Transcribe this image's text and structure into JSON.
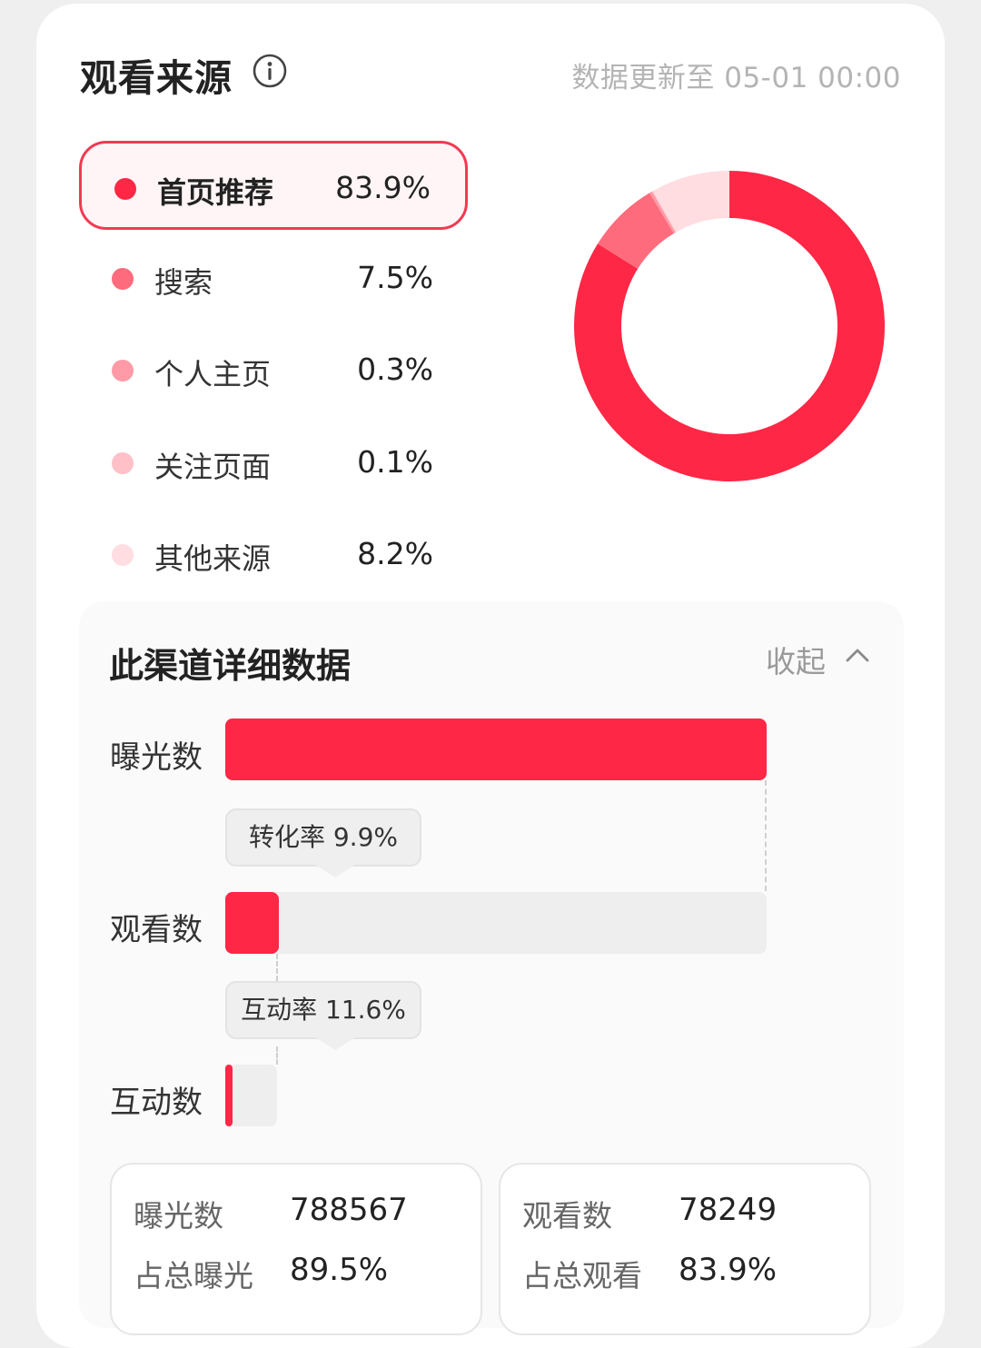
{
  "header": {
    "title": "观看来源",
    "update_time": "数据更新至 05-01 00:00"
  },
  "legend": [
    {
      "label": "首页推荐",
      "value": "83.9%",
      "color": "#fe2745",
      "active": true
    },
    {
      "label": "搜索",
      "value": "7.5%",
      "color": "#fe6b7c"
    },
    {
      "label": "个人主页",
      "value": "0.3%",
      "color": "#ff9aa6"
    },
    {
      "label": "关注页面",
      "value": "0.1%",
      "color": "#ffc0c7"
    },
    {
      "label": "其他来源",
      "value": "8.2%",
      "color": "#ffdde1"
    }
  ],
  "chart_data": {
    "type": "pie",
    "categories": [
      "首页推荐",
      "搜索",
      "个人主页",
      "关注页面",
      "其他来源"
    ],
    "values": [
      83.9,
      7.5,
      0.3,
      0.1,
      8.2
    ],
    "colors": [
      "#fe2745",
      "#fe6b7c",
      "#ff9aa6",
      "#ffc0c7",
      "#ffdde1"
    ]
  },
  "detail": {
    "title": "此渠道详细数据",
    "collapse_label": "收起",
    "rows": [
      {
        "label": "曝光数",
        "fraction": 1.0
      },
      {
        "label": "观看数",
        "fraction": 0.099
      },
      {
        "label": "互动数",
        "fraction": 0.0115
      }
    ],
    "rates": [
      {
        "label": "转化率 9.9%"
      },
      {
        "label": "互动率 11.6%"
      }
    ]
  },
  "stats": [
    {
      "k1": "曝光数",
      "v1": "788567",
      "k2": "占总曝光",
      "v2": "89.5%"
    },
    {
      "k1": "观看数",
      "v1": "78249",
      "k2": "占总观看",
      "v2": "83.9%"
    }
  ]
}
